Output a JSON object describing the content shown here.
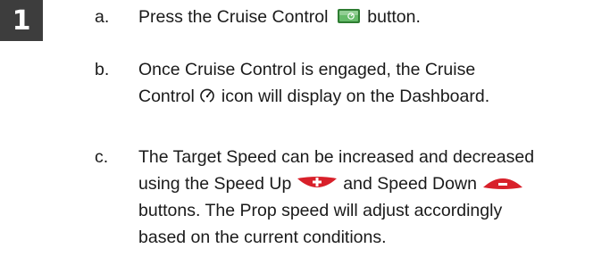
{
  "step": {
    "number": "1"
  },
  "items": [
    {
      "letter": "a.",
      "line1_before": "Press the Cruise Control",
      "line1_after": "button.",
      "icon": "cruise-control-button-icon"
    },
    {
      "letter": "b.",
      "line1": "Once Cruise Control is engaged, the Cruise",
      "line2_before": "Control",
      "line2_after": "icon will display on the Dashboard.",
      "icon": "cruise-control-dashboard-icon"
    },
    {
      "letter": "c.",
      "line1": "The Target Speed can be increased and decreased",
      "line2_a": "using the Speed Up",
      "line2_b": "and Speed Down",
      "line3": "buttons. The Prop speed will adjust accordingly",
      "line4": "based on the current conditions.",
      "icons": [
        "speed-up-button-icon",
        "speed-down-button-icon"
      ]
    }
  ],
  "colors": {
    "badge_bg": "#3d3d3d",
    "cruise_button_green": "#4caf50",
    "speed_button_red": "#d8202a"
  }
}
